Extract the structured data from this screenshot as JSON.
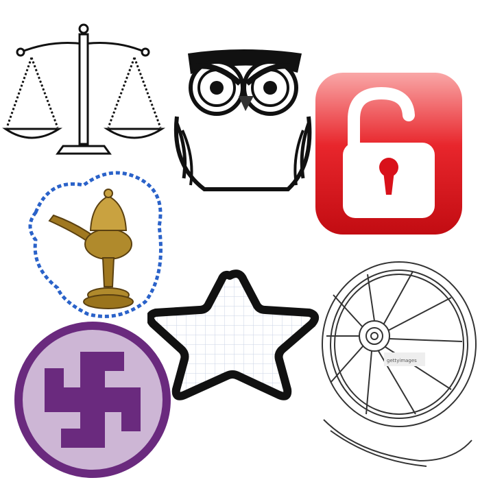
{
  "icons": [
    {
      "name": "scales-of-justice-icon"
    },
    {
      "name": "owl-icon"
    },
    {
      "name": "unlocked-padlock-icon",
      "accent": "#d9111a"
    },
    {
      "name": "oil-lamp-icon",
      "accent": "#b08a2c"
    },
    {
      "name": "star-outline-icon"
    },
    {
      "name": "wagon-wheel-icon"
    },
    {
      "name": "swastika-icon",
      "accent": "#6a2a7e"
    }
  ],
  "watermark": {
    "text": "gettyimages"
  },
  "colors": {
    "lock_red": "#d9111a",
    "lamp_brass": "#b08a2c",
    "lamp_halo": "#2a62c9",
    "swastika_purple": "#6a2a7e",
    "swastika_bg": "#cdb6d5"
  }
}
